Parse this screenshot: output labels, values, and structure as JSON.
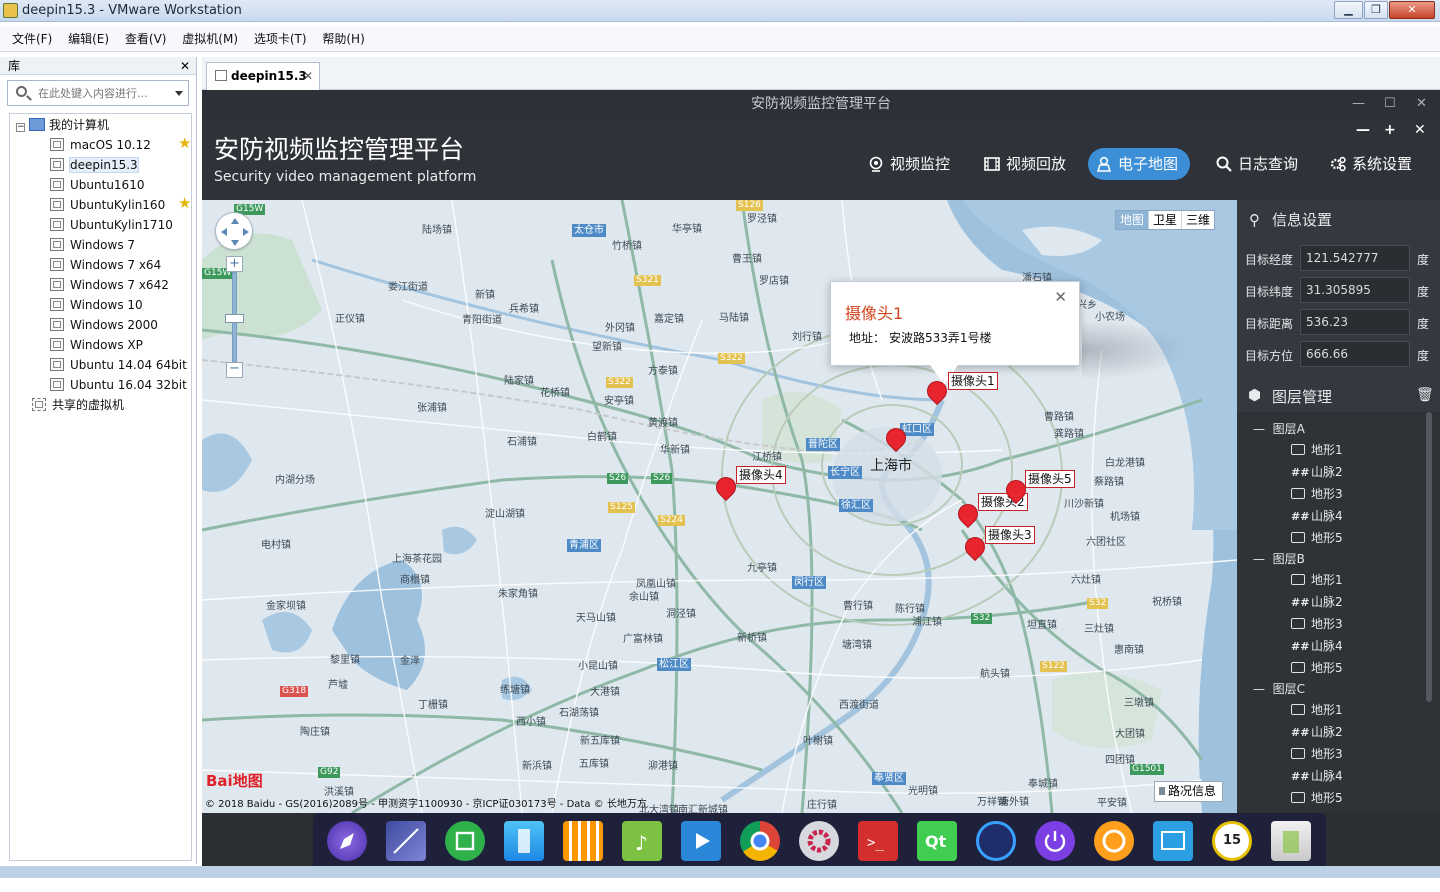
{
  "window": {
    "title": "deepin15.3 - VMware Workstation"
  },
  "menu": [
    "文件(F)",
    "编辑(E)",
    "查看(V)",
    "虚拟机(M)",
    "选项卡(T)",
    "帮助(H)"
  ],
  "library": {
    "header": "库",
    "search_placeholder": "在此处键入内容进行...",
    "root": "我的计算机",
    "items": [
      "macOS 10.12",
      "deepin15.3",
      "Ubuntu1610",
      "UbuntuKylin160",
      "UbuntuKylin1710",
      "Windows 7",
      "Windows 7 x64",
      "Windows 7 x642",
      "Windows 10",
      "Windows 2000",
      "Windows XP",
      "Ubuntu 14.04 64bit",
      "Ubuntu 16.04 32bit"
    ],
    "shared": "共享的虚拟机"
  },
  "tab": {
    "label": "deepin15.3"
  },
  "guest": {
    "window_title": "安防视频监控管理平台",
    "app_title": "安防视频监控管理平台",
    "app_subtitle": "Security video management platform",
    "nav": [
      "视频监控",
      "视频回放",
      "电子地图",
      "日志查询",
      "系统设置"
    ],
    "active_nav": "电子地图"
  },
  "map": {
    "type_buttons": [
      "地图",
      "卫星",
      "三维"
    ],
    "popup": {
      "title": "摄像头1",
      "address_label": "地址：",
      "address": "安波路533弄1号楼"
    },
    "cameras": [
      "摄像头1",
      "摄像头2",
      "摄像头3",
      "摄像头4",
      "摄像头5"
    ],
    "labels": [
      "陆场镇",
      "华亭镇",
      "罗泾镇",
      "竹桥镇",
      "曹王镇",
      "罗店镇",
      "潘石镇",
      "娄江街道",
      "新镇",
      "兵希镇",
      "正仪镇",
      "青阳街道",
      "外冈镇",
      "嘉定镇",
      "马陆镇",
      "刘行镇",
      "望新镇",
      "方泰镇",
      "陆家镇",
      "花桥镇",
      "安亭镇",
      "黄渡镇",
      "张浦镇",
      "石浦镇",
      "白鹤镇",
      "华新镇",
      "江桥镇",
      "曹路镇",
      "龚路镇",
      "白龙港镇",
      "蔡路镇",
      "川沙新镇",
      "机场镇",
      "六团社区",
      "内湖分场",
      "淀山湖镇",
      "电村镇",
      "上海茶花园",
      "商榻镇",
      "朱家角镇",
      "凤凰山镇",
      "余山镇",
      "天马山镇",
      "洞泾镇",
      "九亭镇",
      "曹行镇",
      "陈行镇",
      "浦江镇",
      "六灶镇",
      "坦直镇",
      "三灶镇",
      "惠南镇",
      "祝桥镇",
      "金家坝镇",
      "广富林镇",
      "新桥镇",
      "塘湾镇",
      "黎里镇",
      "金泽",
      "小昆山镇",
      "航头镇",
      "芦墟",
      "丁栅镇",
      "练塘镇",
      "大港镇",
      "石湖荡镇",
      "西渡街道",
      "三墩镇",
      "陶庄镇",
      "西小镇",
      "新五库镇",
      "叶榭镇",
      "大团镇",
      "五库镇",
      "泖港镇",
      "四团镇",
      "庄行镇",
      "奉城镇",
      "洪溪镇",
      "新浜镇",
      "光明镇",
      "塘外镇",
      "平安镇",
      "万祥镇",
      "兴乡",
      "小农场",
      "北大湾镇",
      "南汇新城镇"
    ],
    "city": "上海市",
    "districts": [
      "太仓市",
      "普陀区",
      "虹口区",
      "长宁区",
      "徐汇区",
      "青浦区",
      "闵行区",
      "松江区",
      "奉贤区"
    ],
    "roads": [
      "G15W",
      "S126",
      "G15W",
      "S321",
      "S322",
      "S322",
      "S26",
      "S26",
      "S125",
      "S224",
      "S32",
      "S32",
      "S122",
      "G318",
      "G92",
      "G1501"
    ],
    "logo": "Bai地图",
    "copyright": "© 2018 Baidu - GS(2016)2089号 - 甲测资字1100930 - 京ICP证030173号 - Data © 长地万方",
    "traffic": "路况信息"
  },
  "info": {
    "title": "信息设置",
    "fields": [
      {
        "label": "目标经度",
        "value": "121.542777",
        "unit": "度"
      },
      {
        "label": "目标纬度",
        "value": "31.305895",
        "unit": "度"
      },
      {
        "label": "目标距离",
        "value": "536.23",
        "unit": "度"
      },
      {
        "label": "目标方位",
        "value": "666.66",
        "unit": "度"
      }
    ]
  },
  "layers": {
    "title": "图层管理",
    "groups": [
      {
        "name": "图层A",
        "items": [
          "地形1",
          "山脉2",
          "地形3",
          "山脉4",
          "地形5"
        ]
      },
      {
        "name": "图层B",
        "items": [
          "地形1",
          "山脉2",
          "地形3",
          "山脉4",
          "地形5"
        ]
      },
      {
        "name": "图层C",
        "items": [
          "地形1",
          "山脉2",
          "地形3",
          "山脉4",
          "地形5"
        ]
      }
    ]
  },
  "dock": {
    "clock": "15 05"
  },
  "colors": {
    "accent": "#3c8fd6",
    "header_bg": "#2f3238",
    "panel_bg": "#35393f",
    "pin": "#e8242e"
  }
}
